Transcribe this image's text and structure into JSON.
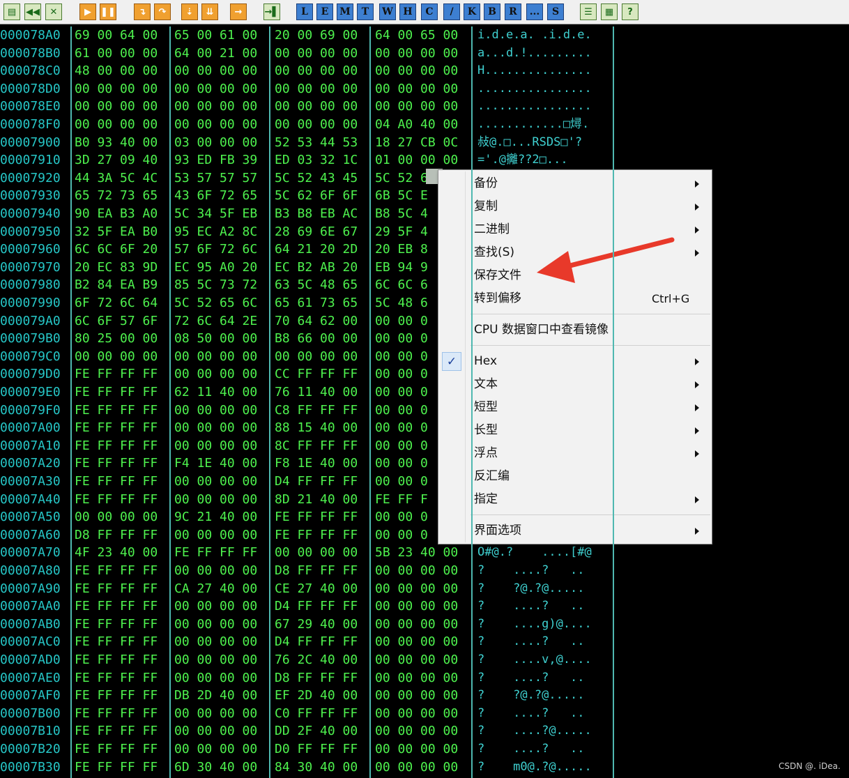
{
  "toolbar": {
    "buttons": [
      {
        "name": "open-icon",
        "glyph": "▤",
        "style": "tb-green"
      },
      {
        "name": "restart-icon",
        "glyph": "◀◀",
        "style": "tb-green"
      },
      {
        "name": "close-icon",
        "glyph": "✕",
        "style": "tb-green"
      },
      {
        "name": "run-icon",
        "glyph": "▶",
        "style": "tb-orange"
      },
      {
        "name": "pause-icon",
        "glyph": "❚❚",
        "style": "tb-orange"
      },
      {
        "name": "step-into-icon",
        "glyph": "↴",
        "style": "tb-orange"
      },
      {
        "name": "step-over-icon",
        "glyph": "↷",
        "style": "tb-orange"
      },
      {
        "name": "trace-into-icon",
        "glyph": "⇣",
        "style": "tb-orange"
      },
      {
        "name": "trace-over-icon",
        "glyph": "⇊",
        "style": "tb-orange"
      },
      {
        "name": "execute-till-return-icon",
        "glyph": "→",
        "style": "tb-orange"
      },
      {
        "name": "go-to-icon",
        "glyph": "→▌",
        "style": "tb-green"
      },
      {
        "name": "log-window-button",
        "glyph": "L",
        "style": "tb-letter"
      },
      {
        "name": "modules-window-button",
        "glyph": "E",
        "style": "tb-letter"
      },
      {
        "name": "memory-window-button",
        "glyph": "M",
        "style": "tb-letter"
      },
      {
        "name": "threads-window-button",
        "glyph": "T",
        "style": "tb-letter"
      },
      {
        "name": "windows-window-button",
        "glyph": "W",
        "style": "tb-letter"
      },
      {
        "name": "handles-window-button",
        "glyph": "H",
        "style": "tb-letter"
      },
      {
        "name": "cpu-window-button",
        "glyph": "C",
        "style": "tb-letter"
      },
      {
        "name": "patches-window-button",
        "glyph": "/",
        "style": "tb-letter"
      },
      {
        "name": "call-stack-window-button",
        "glyph": "K",
        "style": "tb-letter"
      },
      {
        "name": "breakpoints-window-button",
        "glyph": "B",
        "style": "tb-letter"
      },
      {
        "name": "references-window-button",
        "glyph": "R",
        "style": "tb-letter"
      },
      {
        "name": "run-trace-window-button",
        "glyph": "...",
        "style": "tb-letter"
      },
      {
        "name": "source-window-button",
        "glyph": "S",
        "style": "tb-letter"
      },
      {
        "name": "list-icon",
        "glyph": "☰",
        "style": "tb-green"
      },
      {
        "name": "grid-icon",
        "glyph": "▦",
        "style": "tb-green"
      },
      {
        "name": "help-icon",
        "glyph": "?",
        "style": "tb-green"
      }
    ]
  },
  "dump": {
    "rows": [
      {
        "addr": "000078A0",
        "hex": [
          "69 00 64 00",
          "65 00 61 00",
          "20 00 69 00",
          "64 00 65 00"
        ],
        "ascii": "i.d.e.a. .i.d.e."
      },
      {
        "addr": "000078B0",
        "hex": [
          "61 00 00 00",
          "64 00 21 00",
          "00 00 00 00",
          "00 00 00 00"
        ],
        "ascii": "a...d.!........."
      },
      {
        "addr": "000078C0",
        "hex": [
          "48 00 00 00",
          "00 00 00 00",
          "00 00 00 00",
          "00 00 00 00"
        ],
        "ascii": "H..............."
      },
      {
        "addr": "000078D0",
        "hex": [
          "00 00 00 00",
          "00 00 00 00",
          "00 00 00 00",
          "00 00 00 00"
        ],
        "ascii": "................"
      },
      {
        "addr": "000078E0",
        "hex": [
          "00 00 00 00",
          "00 00 00 00",
          "00 00 00 00",
          "00 00 00 00"
        ],
        "ascii": "................"
      },
      {
        "addr": "000078F0",
        "hex": [
          "00 00 00 00",
          "00 00 00 00",
          "00 00 00 00",
          "04 A0 40 00"
        ],
        "ascii": "............□燖."
      },
      {
        "addr": "00007900",
        "hex": [
          "B0 93 40 00",
          "03 00 00 00",
          "52 53 44 53",
          "18 27 CB 0C"
        ],
        "ascii": "敊@.□...RSDS□'?"
      },
      {
        "addr": "00007910",
        "hex": [
          "3D 27 09 40",
          "93 ED FB 39",
          "ED 03 32 1C",
          "01 00 00 00"
        ],
        "ascii": "='.@攡??2□..."
      },
      {
        "addr": "00007920",
        "hex": [
          "44 3A 5C 4C",
          "53 57 57 57",
          "5C 52 43 45",
          "5C 52 6"
        ],
        "ascii": ""
      },
      {
        "addr": "00007930",
        "hex": [
          "65 72 73 65",
          "43 6F 72 65",
          "5C 62 6F 6F",
          "6B 5C E"
        ],
        "ascii": ""
      },
      {
        "addr": "00007940",
        "hex": [
          "90 EA B3 A0",
          "5C 34 5F EB",
          "B3 B8 EB AC",
          "B8 5C 4"
        ],
        "ascii": ""
      },
      {
        "addr": "00007950",
        "hex": [
          "32 5F EA B0",
          "95 EC A2 8C",
          "28 69 6E 67",
          "29 5F 4"
        ],
        "ascii": ""
      },
      {
        "addr": "00007960",
        "hex": [
          "6C 6C 6F 20",
          "57 6F 72 6C",
          "64 21 20 2D",
          "20 EB 8"
        ],
        "ascii": ""
      },
      {
        "addr": "00007970",
        "hex": [
          "20 EC 83 9D",
          "EC 95 A0 20",
          "EC B2 AB 20",
          "EB 94 9"
        ],
        "ascii": ""
      },
      {
        "addr": "00007980",
        "hex": [
          "B2 84 EA B9",
          "85 5C 73 72",
          "63 5C 48 65",
          "6C 6C 6"
        ],
        "ascii": ""
      },
      {
        "addr": "00007990",
        "hex": [
          "6F 72 6C 64",
          "5C 52 65 6C",
          "65 61 73 65",
          "5C 48 6"
        ],
        "ascii": ""
      },
      {
        "addr": "000079A0",
        "hex": [
          "6C 6F 57 6F",
          "72 6C 64 2E",
          "70 64 62 00",
          "00 00 0"
        ],
        "ascii": ""
      },
      {
        "addr": "000079B0",
        "hex": [
          "80 25 00 00",
          "08 50 00 00",
          "B8 66 00 00",
          "00 00 0"
        ],
        "ascii": ""
      },
      {
        "addr": "000079C0",
        "hex": [
          "00 00 00 00",
          "00 00 00 00",
          "00 00 00 00",
          "00 00 0"
        ],
        "ascii": ""
      },
      {
        "addr": "000079D0",
        "hex": [
          "FE FF FF FF",
          "00 00 00 00",
          "CC FF FF FF",
          "00 00 0"
        ],
        "ascii": ""
      },
      {
        "addr": "000079E0",
        "hex": [
          "FE FF FF FF",
          "62 11 40 00",
          "76 11 40 00",
          "00 00 0"
        ],
        "ascii": ""
      },
      {
        "addr": "000079F0",
        "hex": [
          "FE FF FF FF",
          "00 00 00 00",
          "C8 FF FF FF",
          "00 00 0"
        ],
        "ascii": ""
      },
      {
        "addr": "00007A00",
        "hex": [
          "FE FF FF FF",
          "00 00 00 00",
          "88 15 40 00",
          "00 00 0"
        ],
        "ascii": ""
      },
      {
        "addr": "00007A10",
        "hex": [
          "FE FF FF FF",
          "00 00 00 00",
          "8C FF FF FF",
          "00 00 0"
        ],
        "ascii": ""
      },
      {
        "addr": "00007A20",
        "hex": [
          "FE FF FF FF",
          "F4 1E 40 00",
          "F8 1E 40 00",
          "00 00 0"
        ],
        "ascii": ""
      },
      {
        "addr": "00007A30",
        "hex": [
          "FE FF FF FF",
          "00 00 00 00",
          "D4 FF FF FF",
          "00 00 0"
        ],
        "ascii": ""
      },
      {
        "addr": "00007A40",
        "hex": [
          "FE FF FF FF",
          "00 00 00 00",
          "8D 21 40 00",
          "FE FF F"
        ],
        "ascii": ""
      },
      {
        "addr": "00007A50",
        "hex": [
          "00 00 00 00",
          "9C 21 40 00",
          "FE FF FF FF",
          "00 00 0"
        ],
        "ascii": ""
      },
      {
        "addr": "00007A60",
        "hex": [
          "D8 FF FF FF",
          "00 00 00 00",
          "FE FF FF FF",
          "00 00 0"
        ],
        "ascii": ""
      },
      {
        "addr": "00007A70",
        "hex": [
          "4F 23 40 00",
          "FE FF FF FF",
          "00 00 00 00",
          "5B 23 40 00"
        ],
        "ascii": "O#@.?    ....[#@"
      },
      {
        "addr": "00007A80",
        "hex": [
          "FE FF FF FF",
          "00 00 00 00",
          "D8 FF FF FF",
          "00 00 00 00"
        ],
        "ascii": "?    ....?   .."
      },
      {
        "addr": "00007A90",
        "hex": [
          "FE FF FF FF",
          "CA 27 40 00",
          "CE 27 40 00",
          "00 00 00 00"
        ],
        "ascii": "?    ?@.?@....."
      },
      {
        "addr": "00007AA0",
        "hex": [
          "FE FF FF FF",
          "00 00 00 00",
          "D4 FF FF FF",
          "00 00 00 00"
        ],
        "ascii": "?    ....?   .."
      },
      {
        "addr": "00007AB0",
        "hex": [
          "FE FF FF FF",
          "00 00 00 00",
          "67 29 40 00",
          "00 00 00 00"
        ],
        "ascii": "?    ....g)@...."
      },
      {
        "addr": "00007AC0",
        "hex": [
          "FE FF FF FF",
          "00 00 00 00",
          "D4 FF FF FF",
          "00 00 00 00"
        ],
        "ascii": "?    ....?   .."
      },
      {
        "addr": "00007AD0",
        "hex": [
          "FE FF FF FF",
          "00 00 00 00",
          "76 2C 40 00",
          "00 00 00 00"
        ],
        "ascii": "?    ....v,@...."
      },
      {
        "addr": "00007AE0",
        "hex": [
          "FE FF FF FF",
          "00 00 00 00",
          "D8 FF FF FF",
          "00 00 00 00"
        ],
        "ascii": "?    ....?   .."
      },
      {
        "addr": "00007AF0",
        "hex": [
          "FE FF FF FF",
          "DB 2D 40 00",
          "EF 2D 40 00",
          "00 00 00 00"
        ],
        "ascii": "?    ?@.?@....."
      },
      {
        "addr": "00007B00",
        "hex": [
          "FE FF FF FF",
          "00 00 00 00",
          "C0 FF FF FF",
          "00 00 00 00"
        ],
        "ascii": "?    ....?   .."
      },
      {
        "addr": "00007B10",
        "hex": [
          "FE FF FF FF",
          "00 00 00 00",
          "DD 2F 40 00",
          "00 00 00 00"
        ],
        "ascii": "?    ....?@....."
      },
      {
        "addr": "00007B20",
        "hex": [
          "FE FF FF FF",
          "00 00 00 00",
          "D0 FF FF FF",
          "00 00 00 00"
        ],
        "ascii": "?    ....?   .."
      },
      {
        "addr": "00007B30",
        "hex": [
          "FE FF FF FF",
          "6D 30 40 00",
          "84 30 40 00",
          "00 00 00 00"
        ],
        "ascii": "?    m0@.?@....."
      }
    ]
  },
  "context_menu": {
    "items": [
      {
        "name": "menu-item-backup",
        "label": "备份",
        "submenu": true,
        "shortcut": "",
        "checked": false
      },
      {
        "name": "menu-item-copy",
        "label": "复制",
        "submenu": true,
        "shortcut": "",
        "checked": false
      },
      {
        "name": "menu-item-binary",
        "label": "二进制",
        "submenu": true,
        "shortcut": "",
        "checked": false
      },
      {
        "name": "menu-item-search",
        "label": "查找(S)",
        "submenu": true,
        "shortcut": "",
        "checked": false
      },
      {
        "name": "menu-item-save-file",
        "label": "保存文件",
        "submenu": false,
        "shortcut": "",
        "checked": false
      },
      {
        "name": "menu-item-goto-offset",
        "label": "转到偏移",
        "submenu": false,
        "shortcut": "Ctrl+G",
        "checked": false
      },
      {
        "separator": true
      },
      {
        "name": "menu-item-cpu-mirror",
        "label": "CPU 数据窗口中查看镜像",
        "submenu": false,
        "shortcut": "",
        "checked": false
      },
      {
        "separator": true
      },
      {
        "name": "menu-item-hex",
        "label": "Hex",
        "submenu": true,
        "shortcut": "",
        "checked": true
      },
      {
        "name": "menu-item-text",
        "label": "文本",
        "submenu": true,
        "shortcut": "",
        "checked": false
      },
      {
        "name": "menu-item-short",
        "label": "短型",
        "submenu": true,
        "shortcut": "",
        "checked": false
      },
      {
        "name": "menu-item-long",
        "label": "长型",
        "submenu": true,
        "shortcut": "",
        "checked": false
      },
      {
        "name": "menu-item-float",
        "label": "浮点",
        "submenu": true,
        "shortcut": "",
        "checked": false
      },
      {
        "name": "menu-item-disassemble",
        "label": "反汇编",
        "submenu": false,
        "shortcut": "",
        "checked": false
      },
      {
        "name": "menu-item-specify",
        "label": "指定",
        "submenu": true,
        "shortcut": "",
        "checked": false
      },
      {
        "separator": true
      },
      {
        "name": "menu-item-ui-options",
        "label": "界面选项",
        "submenu": true,
        "shortcut": "",
        "checked": false
      }
    ],
    "check_glyph": "✓"
  },
  "annotation": {
    "color": "#e8392a"
  },
  "watermark": {
    "text": "CSDN @. iDea."
  },
  "colors": {
    "address": "#26c6c6",
    "hex": "#4ef24e",
    "ascii": "#3fd0d0",
    "divider": "#4fb8b0",
    "background": "#000000"
  }
}
